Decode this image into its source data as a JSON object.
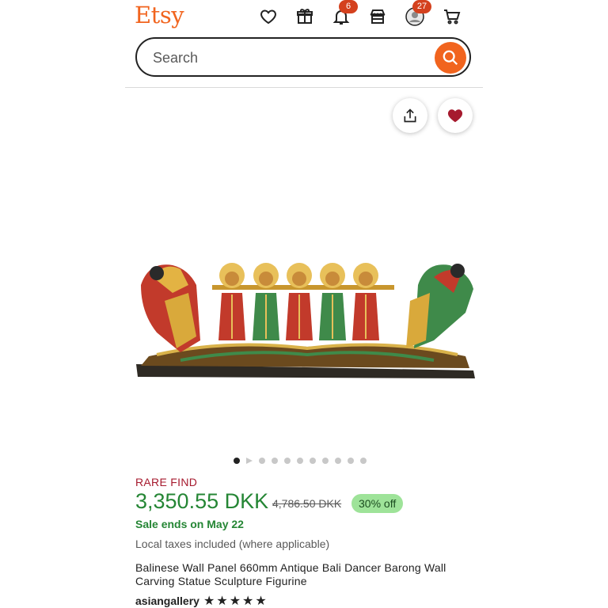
{
  "header": {
    "logo": "Etsy",
    "notifications_count": "6",
    "account_count": "27",
    "icons": [
      "heart-icon",
      "gift-icon",
      "bell-icon",
      "shop-icon",
      "avatar",
      "cart-icon"
    ]
  },
  "search": {
    "placeholder": "Search"
  },
  "gallery": {
    "total_items": 11,
    "active_index": 0
  },
  "product": {
    "badge": "RARE FIND",
    "price": "3,350.55 DKK",
    "original_price": "4,786.50 DKK",
    "discount": "30% off",
    "sale_ends": "Sale ends on May 22",
    "taxes": "Local taxes included (where applicable)",
    "title": "Balinese Wall Panel 660mm Antique Bali Dancer Barong Wall Carving Statue Sculpture Figurine",
    "shop_name": "asiangallery",
    "rating": 5
  },
  "colors": {
    "brand": "#f1641e",
    "price_green": "#258635",
    "rare_find": "#a61a2e",
    "discount_bg": "#9ee399"
  }
}
